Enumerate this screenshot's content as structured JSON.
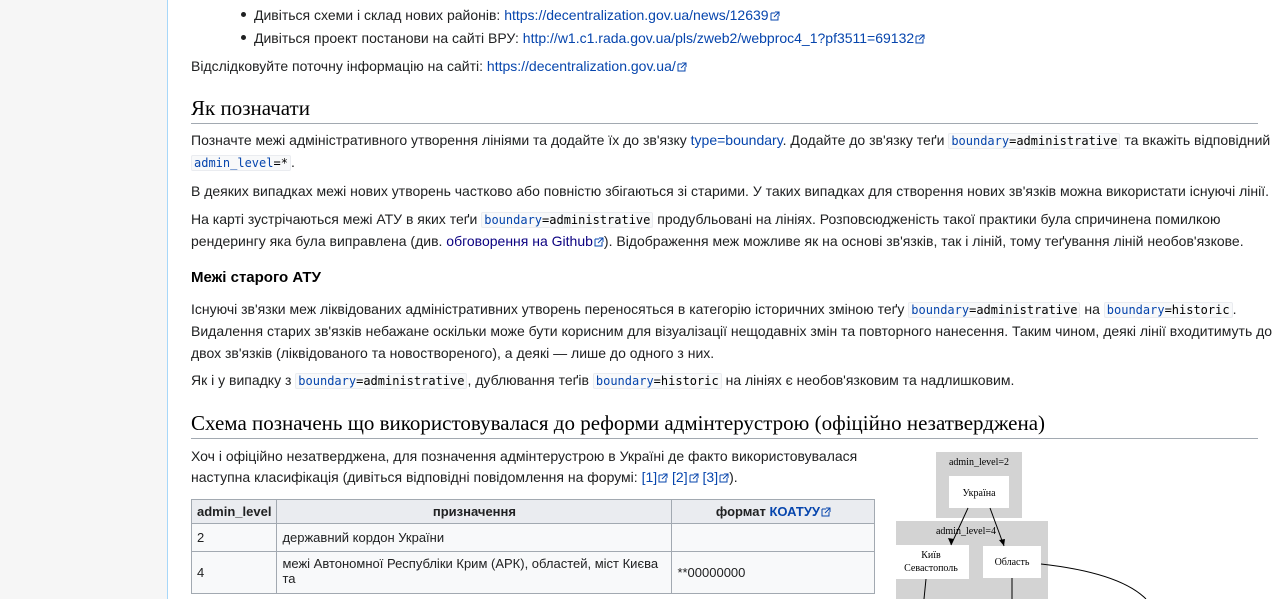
{
  "bullets": [
    {
      "text": "Дивіться схеми і склад нових районів: ",
      "link": "https://decentralization.gov.ua/news/12639"
    },
    {
      "text": "Дивіться проект постанови на сайті ВРУ: ",
      "link": "http://w1.c1.rada.gov.ua/pls/zweb2/webproc4_1?pf3511=69132"
    }
  ],
  "track": {
    "text": "Відслідковуйте поточну інформацію на сайті: ",
    "link": "https://decentralization.gov.ua/"
  },
  "section1": {
    "heading": "Як позначати",
    "p1a": "Позначте межі адміністративного утворення лініями та додайте їх до зв'язку ",
    "p1_typelink": "type=boundary",
    "p1b": ". Додайте до зв'язку теґи ",
    "p1_code1_key": "boundary",
    "p1_code1_val": "=administrative",
    "p1c": " та вкажіть відповідний",
    "p1_code2_key": "admin_level",
    "p1_code2_val": "=*",
    "p1d": ".",
    "p2": "В деяких випадках межі нових утворень частково або повністю збігаються зі старими. У таких випадках для створення нових зв'язків можна використати існуючі лінії.",
    "p3a": "На карті зустрічаються межі АТУ в яких теґи ",
    "p3_code_key": "boundary",
    "p3_code_val": "=administrative",
    "p3b": " продубльовані на лініях. Розповсюдженість такої практики була спричинена помилкою",
    "p3c": "рендерингу яка була виправлена (див. ",
    "p3_link": "обговорення на Github",
    "p3d": "). Відображення меж можливе як на основі зв'язків, так і ліній, тому теґування ліній необов'язкове."
  },
  "section2": {
    "heading": "Межі старого АТУ",
    "p1a": "Існуючі зв'язки меж ліквідованих адміністративних утворень переносяться в категорію історичних зміною теґу ",
    "code1_key": "boundary",
    "code1_val": "=administrative",
    "p1b": " на ",
    "code2_key": "boundary",
    "code2_val": "=historic",
    "p1c": ".",
    "p2": "Видалення старих зв'язків небажане оскільки може бути корисним для візуалізації нещодавніх змін та повторного нанесення. Таким чином, деякі лінії входитимуть до",
    "p3": "двох зв'язків (ліквідованого та новоствореного), а деякі — лише до одного з них.",
    "p4a": "Як і у випадку з ",
    "p4_code1_key": "boundary",
    "p4_code1_val": "=administrative",
    "p4b": ", дублювання теґів ",
    "p4_code2_key": "boundary",
    "p4_code2_val": "=historic",
    "p4c": " на лініях є необов'язковим та надлишковим."
  },
  "section3": {
    "heading": "Схема позначень що використовувалася до реформи адмінтерустрою (офіційно незатверджена)",
    "p1": "Хоч і офіційно незатверджена, для позначення адмінтерустрою в Україні де факто використовувалася",
    "p2": "наступна класифікація (дивіться відповідні повідомлення на форумі: ",
    "ref1": "[1]",
    "ref2": "[2]",
    "ref3": "[3]",
    "p2end": ")."
  },
  "table": {
    "headers": [
      "admin_level",
      "призначення",
      "формат "
    ],
    "header_link": "КОАТУУ",
    "rows": [
      {
        "level": "2",
        "purpose": "державний кордон України",
        "format": ""
      },
      {
        "level": "4",
        "purpose": "межі Автономної Республіки Крим (АРК), областей, міст Києва та",
        "format": "**00000000"
      }
    ]
  },
  "graph": {
    "cluster1": "admin_level=2",
    "node_ukraine": "Україна",
    "cluster2": "admin_level=4",
    "node_kyiv1": "Київ",
    "node_kyiv2": "Севастополь",
    "node_oblast": "Область"
  },
  "colors": {
    "link": "#0645ad",
    "visited": "#0b0080",
    "border": "#a2a9b1",
    "cluster": "#d3d3d3"
  }
}
